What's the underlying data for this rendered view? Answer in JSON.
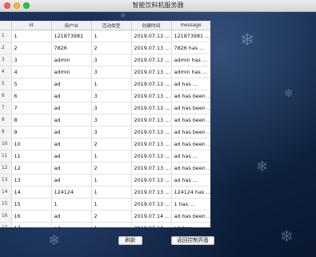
{
  "window": {
    "title": "智能饮料机服务器"
  },
  "table": {
    "columns": [
      "id",
      "用户id",
      "活动类型",
      "创建时间",
      "message"
    ],
    "rows": [
      {
        "num": "1",
        "id": "1",
        "user": "121873981",
        "type": "1",
        "time": "2019.07.13 ...",
        "msg": "121873981 ..."
      },
      {
        "num": "2",
        "id": "2",
        "user": "7826",
        "type": "2",
        "time": "2019.07.13 ...",
        "msg": "7826 has ..."
      },
      {
        "num": "3",
        "id": "3",
        "user": "admin",
        "type": "3",
        "time": "2019.07.13 ...",
        "msg": "admin has ..."
      },
      {
        "num": "4",
        "id": "4",
        "user": "admin",
        "type": "3",
        "time": "2019.07.13 ...",
        "msg": "admin has ..."
      },
      {
        "num": "5",
        "id": "5",
        "user": "ad",
        "type": "1",
        "time": "2019.07.13 ...",
        "msg": "ad has ..."
      },
      {
        "num": "6",
        "id": "6",
        "user": "ad",
        "type": "3",
        "time": "2019.07.13 ...",
        "msg": "ad has been ..."
      },
      {
        "num": "7",
        "id": "7",
        "user": "ad",
        "type": "3",
        "time": "2019.07.13 ...",
        "msg": "ad has been ..."
      },
      {
        "num": "8",
        "id": "8",
        "user": "ad",
        "type": "3",
        "time": "2019.07.13 ...",
        "msg": "ad has been ..."
      },
      {
        "num": "9",
        "id": "9",
        "user": "ad",
        "type": "3",
        "time": "2019.07.13 ...",
        "msg": "ad has been ..."
      },
      {
        "num": "10",
        "id": "10",
        "user": "ad",
        "type": "2",
        "time": "2019.07.13 ...",
        "msg": "ad has been ..."
      },
      {
        "num": "11",
        "id": "11",
        "user": "ad",
        "type": "1",
        "time": "2019.07.13 ...",
        "msg": "ad has ..."
      },
      {
        "num": "12",
        "id": "12",
        "user": "ad",
        "type": "2",
        "time": "2019.07.13 ...",
        "msg": "ad has been ..."
      },
      {
        "num": "13",
        "id": "13",
        "user": "ad",
        "type": "1",
        "time": "2019.07.13 ...",
        "msg": "ad has ..."
      },
      {
        "num": "14",
        "id": "14",
        "user": "124124",
        "type": "1",
        "time": "2019.07.13 ...",
        "msg": "124124 has ..."
      },
      {
        "num": "15",
        "id": "15",
        "user": "1",
        "type": "1",
        "time": "2019.07.13 ...",
        "msg": "1 has ..."
      },
      {
        "num": "16",
        "id": "16",
        "user": "ad",
        "type": "2",
        "time": "2019.07.14 ...",
        "msg": "ad has been ..."
      },
      {
        "num": "17",
        "id": "17",
        "user": "ad",
        "type": "1",
        "time": "2019.07.14 ...",
        "msg": "ad has ..."
      }
    ]
  },
  "buttons": {
    "refresh": "刷新",
    "back": "返回控制界面"
  }
}
